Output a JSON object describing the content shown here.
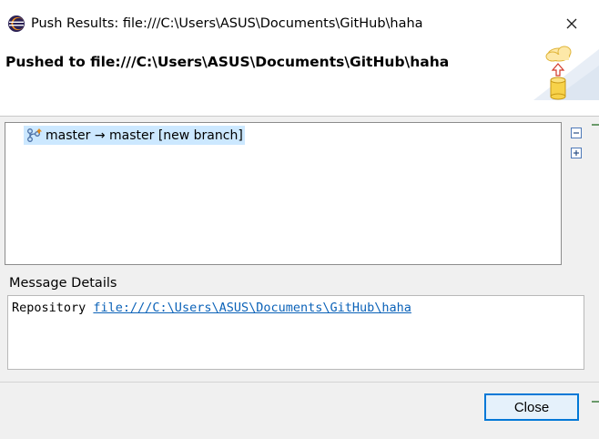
{
  "window": {
    "title": "Push Results: file:///C:\\Users\\ASUS\\Documents\\GitHub\\haha"
  },
  "header": {
    "title": "Pushed to file:///C:\\Users\\ASUS\\Documents\\GitHub\\haha",
    "icon": "cloud-push-icon"
  },
  "results": {
    "items": [
      {
        "label": "master → master [new branch]",
        "icon": "branch-push-icon",
        "selected": true
      }
    ],
    "toolbar": [
      "collapse-all-icon",
      "expand-all-icon"
    ]
  },
  "details": {
    "label": "Message Details",
    "prefix": "Repository ",
    "link": "file:///C:\\Users\\ASUS\\Documents\\GitHub\\haha"
  },
  "buttons": {
    "close": "Close"
  },
  "colors": {
    "selection": "#cce8ff",
    "link": "#0b62b8",
    "default_button_border": "#0078d7",
    "default_button_bg": "#e5f1fb"
  }
}
